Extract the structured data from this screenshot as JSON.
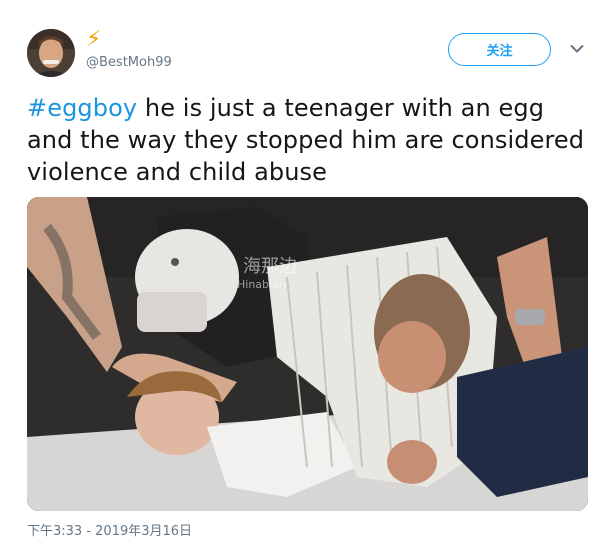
{
  "tweet": {
    "display_name": "⚡",
    "handle": "@BestMoh99",
    "follow_label": "关注",
    "text_hashtag": "#eggboy",
    "text_body": " he is just a teenager  with an egg and the way they stopped him are considered violence and child abuse",
    "timestamp": "下午3:33 - 2019年3月16日"
  },
  "media": {
    "watermark_main": "海那边",
    "watermark_sub": "Hinabian"
  },
  "icons": {
    "menu": "chevron-down-icon",
    "verified": "lightning-icon"
  },
  "colors": {
    "accent": "#1da1f2",
    "hashtag": "#1b95e0",
    "text": "#14171a",
    "secondary": "#657786"
  }
}
